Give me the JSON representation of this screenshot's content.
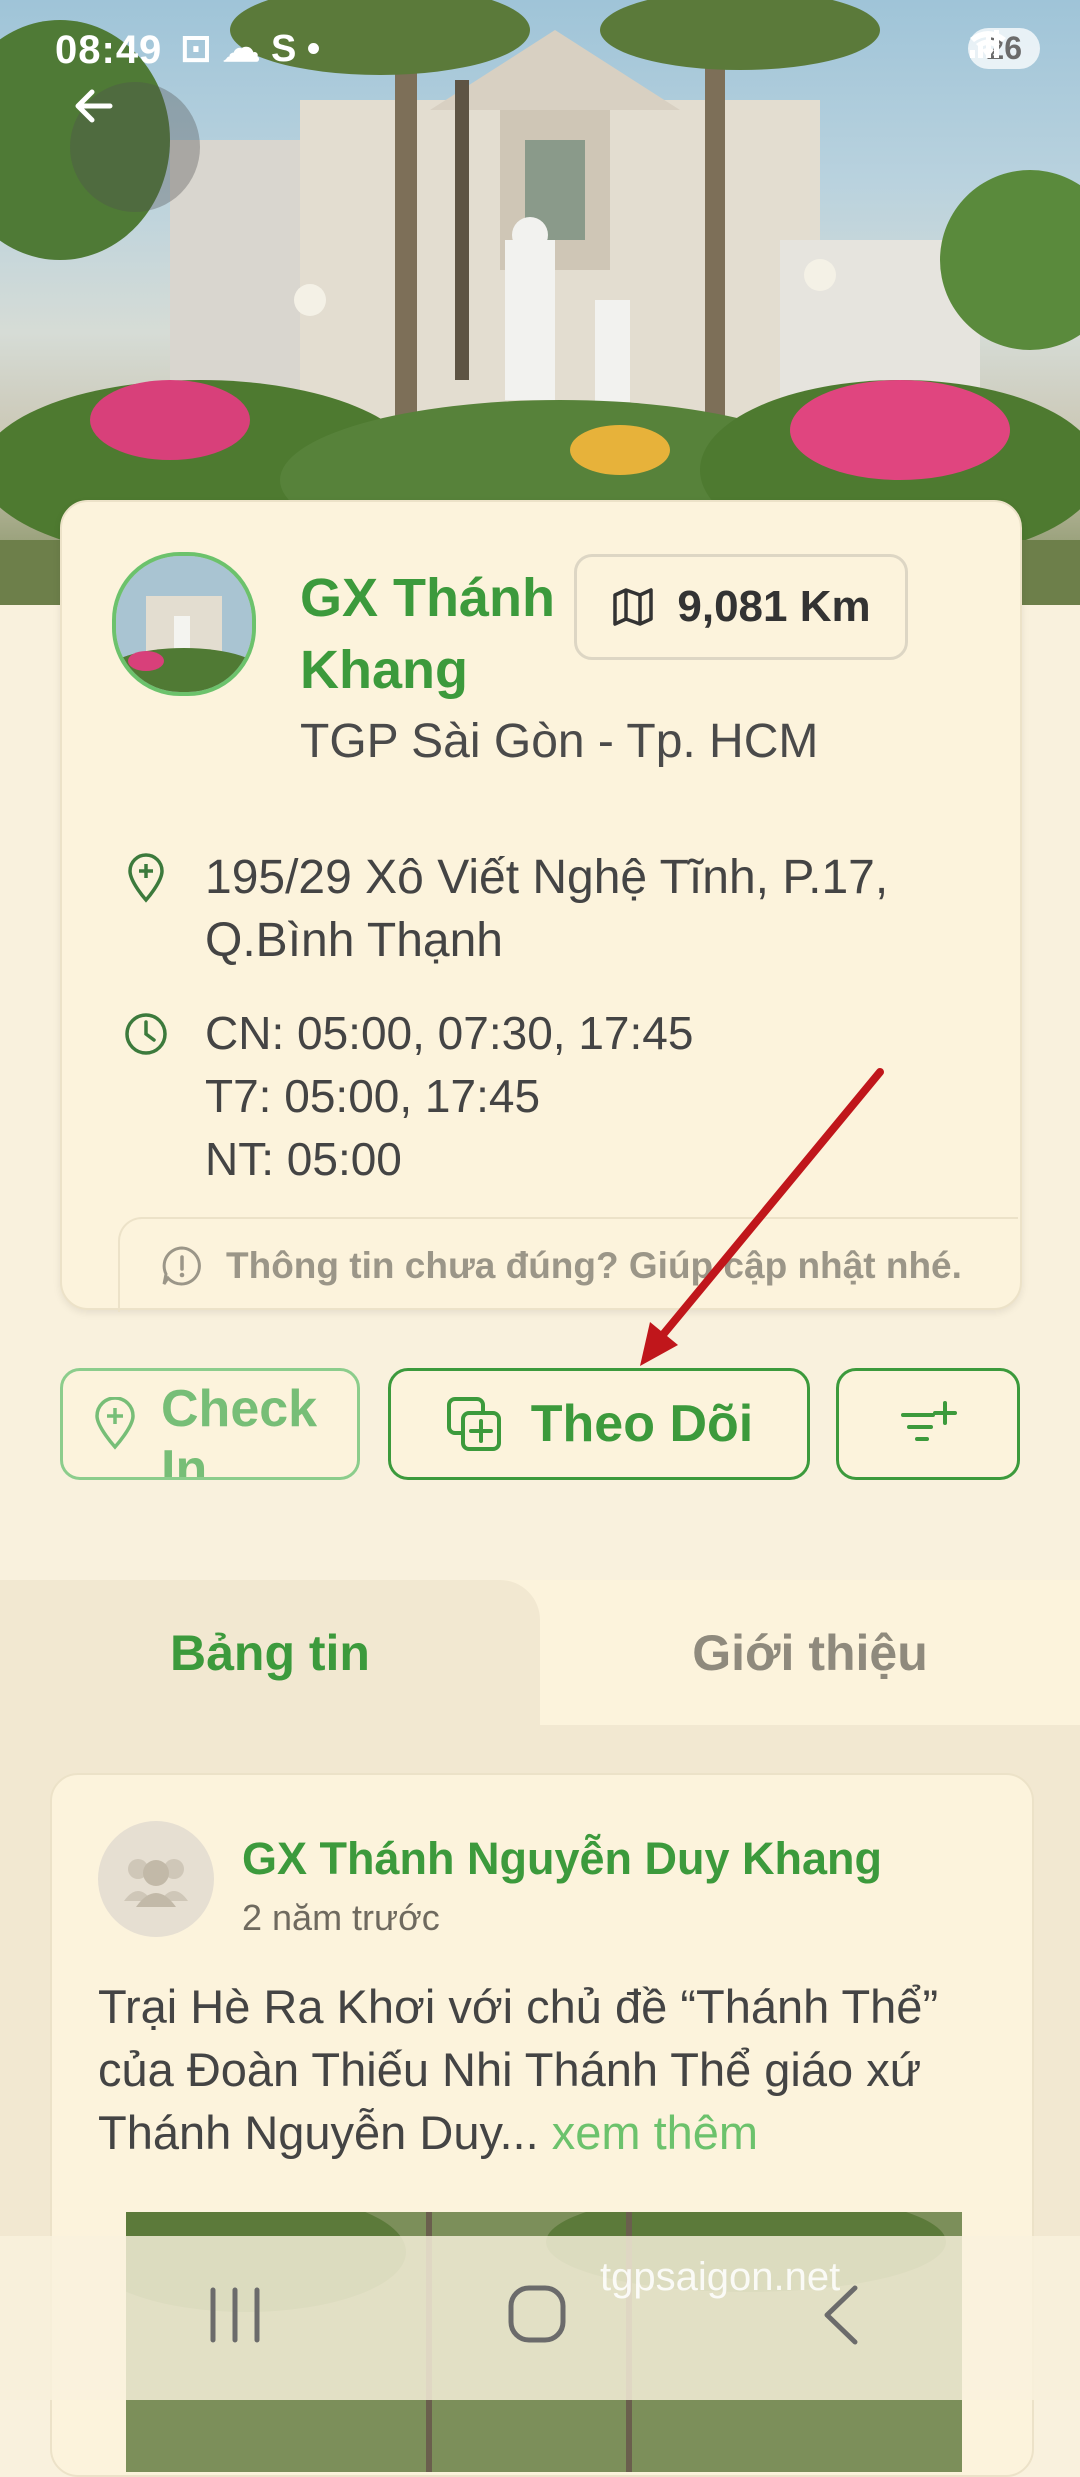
{
  "status_bar": {
    "time": "08:49",
    "notification_icons": "⊡ ☁ S •",
    "battery": "26"
  },
  "header": {
    "back_icon": "arrow-left-icon"
  },
  "parish": {
    "name": "GX Thánh Khang",
    "distance": "9,081 Km",
    "diocese": "TGP Sài Gòn - Tp. HCM",
    "address_lines": [
      "195/29 Xô Viết Nghệ Tĩnh, P.17,",
      "Q.Bình Thạnh"
    ],
    "schedule": [
      "CN: 05:00, 07:30, 17:45",
      "T7: 05:00, 17:45",
      "NT: 05:00"
    ],
    "report_text": "Thông tin chưa đúng? Giúp cập nhật nhé."
  },
  "actions": {
    "checkin_label": "Check In",
    "follow_label": "Theo Dõi",
    "filter_icon": "filter-add-icon"
  },
  "tabs": [
    {
      "label": "Bảng tin",
      "active": true
    },
    {
      "label": "Giới thiệu",
      "active": false
    }
  ],
  "post": {
    "author": "GX Thánh Nguyễn Duy Khang",
    "time": "2 năm trước",
    "text": "Trại Hè Ra Khơi với chủ đề “Thánh Thể” của Đoàn Thiếu Nhi Thánh Thể giáo xứ Thánh Nguyễn Duy...",
    "see_more": "xem thêm"
  },
  "watermark": "tgpsaigon.net",
  "colors": {
    "accent": "#3c9a3c",
    "background": "#f9f1dd",
    "card": "#fcf3dc",
    "annotation_arrow": "#c0161b"
  }
}
